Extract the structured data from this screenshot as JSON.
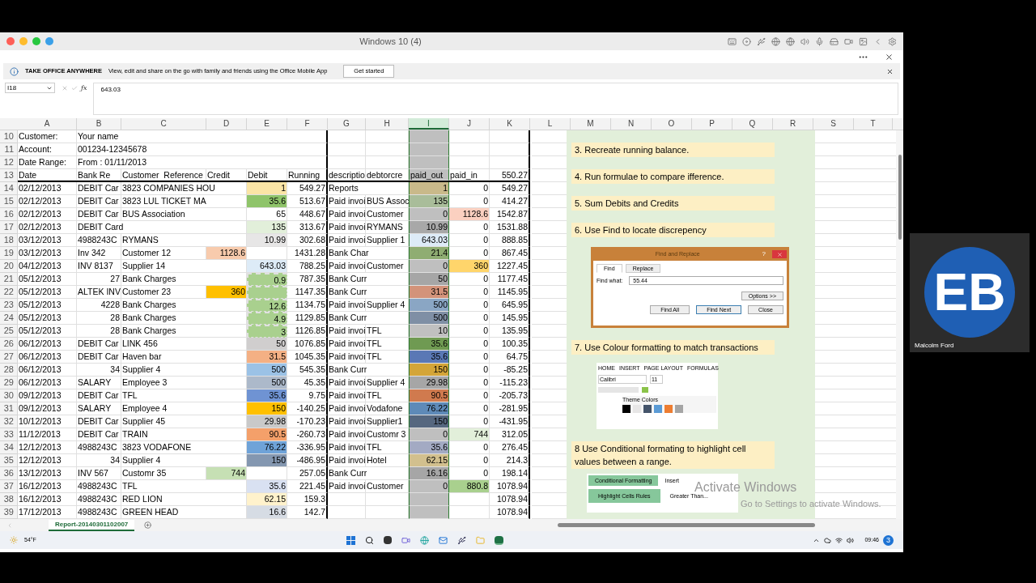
{
  "window": {
    "title": "Windows 10 (4)"
  },
  "info_bar": {
    "title": "TAKE OFFICE ANYWHERE",
    "message": "View, edit and share on the go with family and friends using the Office Mobile App",
    "button": "Get started"
  },
  "formula_bar": {
    "name_box": "I18",
    "fx": "ƒx",
    "value": "643.03"
  },
  "columns": [
    {
      "label": "A",
      "selected": false
    },
    {
      "label": "B",
      "selected": false
    },
    {
      "label": "C",
      "selected": false
    },
    {
      "label": "D",
      "selected": false
    },
    {
      "label": "E",
      "selected": false
    },
    {
      "label": "F",
      "selected": false
    },
    {
      "label": "G",
      "selected": false
    },
    {
      "label": "H",
      "selected": false
    },
    {
      "label": "I",
      "selected": true
    },
    {
      "label": "J",
      "selected": false
    },
    {
      "label": "K",
      "selected": false
    },
    {
      "label": "L",
      "selected": false
    },
    {
      "label": "M",
      "selected": false
    },
    {
      "label": "N",
      "selected": false
    },
    {
      "label": "O",
      "selected": false
    },
    {
      "label": "P",
      "selected": false
    },
    {
      "label": "Q",
      "selected": false
    },
    {
      "label": "R",
      "selected": false
    },
    {
      "label": "S",
      "selected": false
    },
    {
      "label": "T",
      "selected": false
    }
  ],
  "rows": [
    {
      "number": "10",
      "cells": [
        "Customer:",
        "Your name",
        "",
        "",
        "",
        "",
        "",
        "",
        "",
        "",
        ""
      ]
    },
    {
      "number": "11",
      "cells": [
        "Account:",
        "001234-12345678",
        "",
        "",
        "",
        "",
        "",
        "",
        "",
        "",
        ""
      ]
    },
    {
      "number": "12",
      "cells": [
        "Date Range:",
        "From : 01/11/2013",
        "",
        "",
        "",
        "",
        "",
        "",
        "",
        "",
        ""
      ]
    },
    {
      "number": "13",
      "header": true,
      "cells": [
        {
          "text": "Date",
          "kind": "text"
        },
        "Bank Re",
        "Customer  Reference",
        {
          "text": "Credit",
          "kind": "text"
        },
        {
          "text": "Debit",
          "kind": "text"
        },
        {
          "text": "Running",
          "kind": "text"
        },
        "descriptio",
        "debtorcre",
        {
          "text": "paid_out",
          "kind": "text"
        },
        {
          "text": "paid_in",
          "kind": "text"
        },
        "550.27"
      ]
    },
    {
      "number": "14",
      "cells": [
        "02/12/2013",
        "DEBIT Car",
        "3823 COMPANIES HOU",
        "",
        {
          "text": "1",
          "color": "#fbe5a6"
        },
        "549.27",
        "Reports",
        "",
        {
          "text": "1",
          "color": "#c9b98a"
        },
        "0",
        "549.27"
      ]
    },
    {
      "number": "15",
      "cells": [
        "02/12/2013",
        "DEBIT Car",
        "3823 LUL TICKET MA",
        "",
        {
          "text": "35.6",
          "color": "#8fc46a"
        },
        "513.67",
        "Paid invoi",
        "BUS Assoc",
        {
          "text": "135",
          "color": "#a9bd9a"
        },
        "0",
        "414.27"
      ]
    },
    {
      "number": "16",
      "cells": [
        "02/12/2013",
        "DEBIT Car",
        "BUS Association",
        "",
        "65",
        "448.67",
        "Paid invoi",
        "Customer",
        "0",
        {
          "text": "1128.6",
          "color": "#fbd0c0"
        },
        "1542.87"
      ]
    },
    {
      "number": "17",
      "cells": [
        "02/12/2013",
        "DEBIT Card",
        "",
        "",
        {
          "text": "135",
          "color": "#e2efda"
        },
        "313.67",
        "Paid invoi",
        "RYMANS",
        {
          "text": "10.99",
          "color": "#a8a8a8"
        },
        "0",
        "1531.88"
      ]
    },
    {
      "number": "18",
      "cells": [
        "03/12/2013",
        "4988243C",
        "RYMANS",
        "",
        {
          "text": "10.99",
          "color": "#e7e6e6"
        },
        "302.68",
        "Paid invoi",
        "Supplier 1",
        {
          "text": "643.03",
          "color": "#ddebf7"
        },
        "0",
        "888.85"
      ]
    },
    {
      "number": "19",
      "cells": [
        "03/12/2013",
        "Inv 342",
        "Customer 12",
        {
          "text": "1128.6",
          "color": "#f8cbad"
        },
        "",
        "1431.28",
        "Bank Char",
        "",
        {
          "text": "21.4",
          "color": "#8fad72"
        },
        "0",
        "867.45"
      ]
    },
    {
      "number": "20",
      "cells": [
        "04/12/2013",
        "INV 8137",
        "Supplier 14",
        "",
        {
          "text": "643.03",
          "color": "#ddebf7"
        },
        "788.25",
        "Paid invoi",
        "Customer",
        "0",
        {
          "text": "360",
          "color": "#ffd56b"
        },
        "1227.45"
      ]
    },
    {
      "number": "21",
      "cells": [
        "05/12/2013",
        {
          "text": "27",
          "kind": "number"
        },
        "Bank Charges",
        "",
        {
          "text": "0.9",
          "color": "#a9d08e",
          "copied": true
        },
        "787.35",
        "Bank Curr",
        "",
        {
          "text": "50",
          "color": "#a6a6a6"
        },
        "0",
        "1177.45"
      ]
    },
    {
      "number": "22",
      "cells": [
        "05/12/2013",
        "ALTEK INV",
        "Customer 23",
        {
          "text": "360",
          "color": "#ffc000"
        },
        {
          "text": "",
          "color": "#a9d08e",
          "copied": true
        },
        "1147.35",
        "Bank Curr",
        "",
        {
          "text": "31.5",
          "color": "#d3937a"
        },
        "0",
        "1145.95"
      ]
    },
    {
      "number": "23",
      "cells": [
        "05/12/2013",
        {
          "text": "4228",
          "kind": "number"
        },
        "Bank Charges",
        "",
        {
          "text": "12.6",
          "color": "#a9d08e",
          "copied": true
        },
        "1134.75",
        "Paid invoi",
        "Supplier 4",
        {
          "text": "500",
          "color": "#8aa6c4"
        },
        "0",
        "645.95"
      ]
    },
    {
      "number": "24",
      "cells": [
        "05/12/2013",
        {
          "text": "28",
          "kind": "number"
        },
        "Bank Charges",
        "",
        {
          "text": "4.9",
          "color": "#a9d08e",
          "copied": true
        },
        "1129.85",
        "Bank Curr",
        "",
        {
          "text": "500",
          "color": "#7f8fa5"
        },
        "0",
        "145.95"
      ]
    },
    {
      "number": "25",
      "cells": [
        "05/12/2013",
        {
          "text": "28",
          "kind": "number"
        },
        "Bank Charges",
        "",
        {
          "text": "3",
          "color": "#a9d08e",
          "copied": true
        },
        "1126.85",
        "Paid invoi",
        "TFL",
        {
          "text": "10",
          "color": "#c0c0c0"
        },
        "0",
        "135.95"
      ]
    },
    {
      "number": "26",
      "cells": [
        "06/12/2013",
        "DEBIT Car",
        "LINK 456",
        "",
        {
          "text": "50",
          "color": "#d0cece"
        },
        "1076.85",
        "Paid invoi",
        "TFL",
        {
          "text": "35.6",
          "color": "#6f9a52"
        },
        "0",
        "100.35"
      ]
    },
    {
      "number": "27",
      "cells": [
        "06/12/2013",
        "DEBIT Car",
        "Haven bar",
        "",
        {
          "text": "31.5",
          "color": "#f4b084"
        },
        "1045.35",
        "Paid invoi",
        "TFL",
        {
          "text": "35.6",
          "color": "#5a78b5"
        },
        "0",
        "64.75"
      ]
    },
    {
      "number": "28",
      "cells": [
        "06/12/2013",
        {
          "text": "34",
          "kind": "number"
        },
        "Supplier 4",
        "",
        {
          "text": "500",
          "color": "#9bc2e6"
        },
        "545.35",
        "Bank Curr",
        "",
        {
          "text": "150",
          "color": "#d4a538"
        },
        "0",
        "-85.25"
      ]
    },
    {
      "number": "29",
      "cells": [
        "06/12/2013",
        "SALARY",
        "Employee 3",
        "",
        {
          "text": "500",
          "color": "#acb9ca"
        },
        "45.35",
        "Paid invoi",
        "Supplier 4",
        {
          "text": "29.98",
          "color": "#a6a6a6"
        },
        "0",
        "-115.23"
      ]
    },
    {
      "number": "30",
      "cells": [
        "09/12/2013",
        "DEBIT Car",
        "TFL",
        "",
        {
          "text": "35.6",
          "color": "#6f93d3"
        },
        "9.75",
        "Paid invoi",
        "TFL",
        {
          "text": "90.5",
          "color": "#d07a4e"
        },
        "0",
        "-205.73"
      ]
    },
    {
      "number": "31",
      "cells": [
        "09/12/2013",
        "SALARY",
        "Employee 4",
        "",
        {
          "text": "150",
          "color": "#ffc000"
        },
        "-140.25",
        "Paid invoi",
        "Vodafone",
        {
          "text": "76.22",
          "color": "#5e8ab8"
        },
        "0",
        "-281.95"
      ]
    },
    {
      "number": "32",
      "cells": [
        "10/12/2013",
        "DEBIT Car",
        "Supplier 45",
        "",
        {
          "text": "29.98",
          "color": "#c9c9c9"
        },
        "-170.23",
        "Paid invoi",
        "Supplier1",
        {
          "text": "150",
          "color": "#56677f"
        },
        "0",
        "-431.95"
      ]
    },
    {
      "number": "33",
      "cells": [
        "11/12/2013",
        "DEBIT Car",
        "TRAIN",
        "",
        {
          "text": "90.5",
          "color": "#f4a06a"
        },
        "-260.73",
        "Paid invoi",
        "Customr 3",
        "0",
        {
          "text": "744",
          "color": "#e2efda"
        },
        "312.05"
      ]
    },
    {
      "number": "34",
      "cells": [
        "12/12/2013",
        "4988243C",
        "3823 VODAFONE",
        "",
        {
          "text": "76.22",
          "color": "#6fa3d8"
        },
        "-336.95",
        "Paid invoi",
        "TFL",
        {
          "text": "35.6",
          "color": "#a3aac3"
        },
        "0",
        "276.45"
      ]
    },
    {
      "number": "35",
      "cells": [
        "12/12/2013",
        {
          "text": "34",
          "kind": "number"
        },
        "Supplier 4",
        "",
        {
          "text": "150",
          "color": "#8497b0"
        },
        "-486.95",
        "Paid invoi",
        "Hotel",
        {
          "text": "62.15",
          "color": "#d2c08e"
        },
        "0",
        "214.3"
      ]
    },
    {
      "number": "36",
      "cells": [
        "13/12/2013",
        "INV 567",
        "Customr 35",
        {
          "text": "744",
          "color": "#c6e0b4"
        },
        "",
        "257.05",
        "Bank Curr",
        "",
        {
          "text": "16.16",
          "color": "#a6a6a6"
        },
        "0",
        "198.14"
      ]
    },
    {
      "number": "37",
      "cells": [
        "16/12/2013",
        "4988243C",
        "TFL",
        "",
        {
          "text": "35.6",
          "color": "#d9e1f2"
        },
        "221.45",
        "Paid invoi",
        "Customer",
        "0",
        {
          "text": "880.8",
          "color": "#a9d08e"
        },
        "1078.94"
      ]
    },
    {
      "number": "38",
      "cells": [
        "16/12/2013",
        "4988243C",
        "RED LION",
        "",
        {
          "text": "62.15",
          "color": "#fff2cc"
        },
        "159.3",
        "",
        "",
        "",
        "",
        "1078.94"
      ]
    },
    {
      "number": "39",
      "cells": [
        "17/12/2013",
        "4988243C",
        "GREEN HEAD",
        "",
        {
          "text": "16.6",
          "color": "#d6dce4"
        },
        "142.7",
        "",
        "",
        "",
        "",
        "1078.94"
      ]
    }
  ],
  "notes": [
    {
      "kind": "note",
      "text": "3. Recreate running balance."
    },
    {
      "kind": "note",
      "text": "4. Run formulae to compare ifference."
    },
    {
      "kind": "note",
      "text": "5. Sum Debits and Credits"
    },
    {
      "kind": "note",
      "text": "6. Use Find to locate discrepency"
    },
    {
      "kind": "find-dialog",
      "title": "Find and Replace",
      "help": "?",
      "tabs": [
        {
          "label": "Find",
          "selected": true
        },
        {
          "label": "Replace",
          "selected": false
        }
      ],
      "field_label": "Find what:",
      "field_value": "55.44",
      "buttons": [
        "Options >>",
        "Find All",
        "Find Next",
        "Close"
      ]
    },
    {
      "kind": "note",
      "text": "7. Use Colour formatting to match transactions"
    },
    {
      "kind": "ribbon-image",
      "tabs": [
        "HOME",
        "INSERT",
        "PAGE LAYOUT",
        "FORMULAS"
      ],
      "font": "Calibri",
      "size": "11",
      "palette_title": "Theme Colors",
      "swatches": [
        {
          "color": "#000000"
        },
        {
          "color": "#e7e6e6"
        },
        {
          "color": "#44546a"
        },
        {
          "color": "#5b9bd5"
        },
        {
          "color": "#ed7d31"
        },
        {
          "color": "#a5a5a5"
        }
      ]
    },
    {
      "kind": "note",
      "text": "8 Use Conditional formating to highlight cell values between a range."
    },
    {
      "kind": "cf-image",
      "button": "Conditional Formatting",
      "insert": "Insert",
      "menu_item": "Highlight Cells Rules",
      "sub_item": "Greater Than..."
    }
  ],
  "activation": {
    "title": "Activate Windows",
    "message": "Go to Settings to activate Windows."
  },
  "sheet_tabs": [
    {
      "label": "Report-20140301102007",
      "selected": true
    }
  ],
  "webcam": {
    "logo": "EB",
    "name": "Malcolm Ford"
  },
  "taskbar": {
    "weather": "54°F",
    "time": "09:46",
    "badge": "3"
  }
}
